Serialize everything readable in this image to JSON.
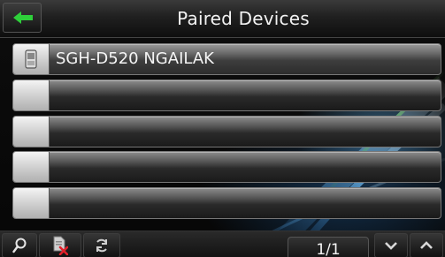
{
  "window": {
    "title": "Paired Devices"
  },
  "devices": [
    {
      "name": "SGH-D520 NGAILAK",
      "icon": "phone-icon"
    },
    {
      "name": ""
    },
    {
      "name": ""
    },
    {
      "name": ""
    },
    {
      "name": ""
    }
  ],
  "toolbar": {
    "page_indicator": "1/1",
    "icons": [
      "search-icon",
      "delete-device-icon",
      "refresh-icon",
      "chevron-down-icon",
      "chevron-up-icon"
    ]
  },
  "colors": {
    "delete_accent": "#e0202a",
    "background": "#000000",
    "glow": "#64beff"
  }
}
